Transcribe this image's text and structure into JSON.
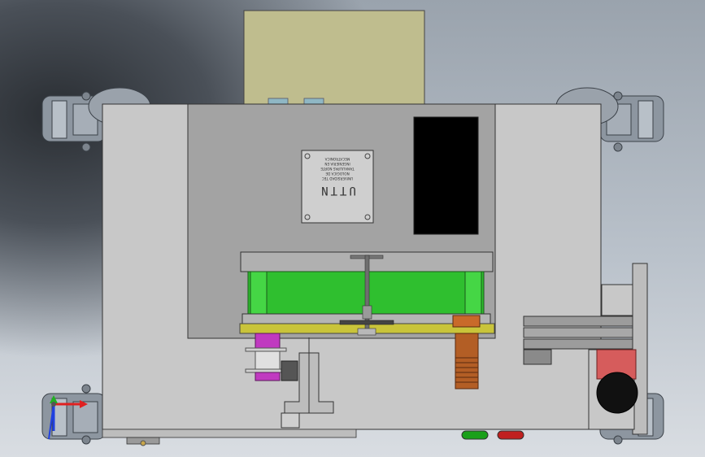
{
  "viewport": {
    "background_top": "#9aa3ad",
    "background_bottom": "#d9dde2",
    "background_shadow": "#2a2e33"
  },
  "model": {
    "plate_color": "#c8c8c8",
    "inner_panel_color": "#a3a3a3",
    "top_box_color": "#bfbd8e",
    "green_block_color": "#2fbf2f",
    "yellow_plate_color": "#c9c43a",
    "magenta_color": "#c03ac0",
    "copper_color": "#b35e25",
    "red_spool_color": "#d65c5c",
    "display_color": "#000000"
  },
  "nameplate": {
    "title": "UTTN",
    "lines": [
      "UNIVERSIDAD TEC",
      "NOLOGICA DE",
      "TAMAULIPAS NORTE",
      "INGENIERIA EN",
      "MECATRONICA"
    ]
  },
  "triad": {
    "x_color": "#e02020",
    "y_color": "#20b020",
    "z_color": "#2040e0",
    "icon": "coordinate-triad-icon"
  },
  "indicators": {
    "green_led": "#1aa01a",
    "red_led": "#c02020"
  }
}
